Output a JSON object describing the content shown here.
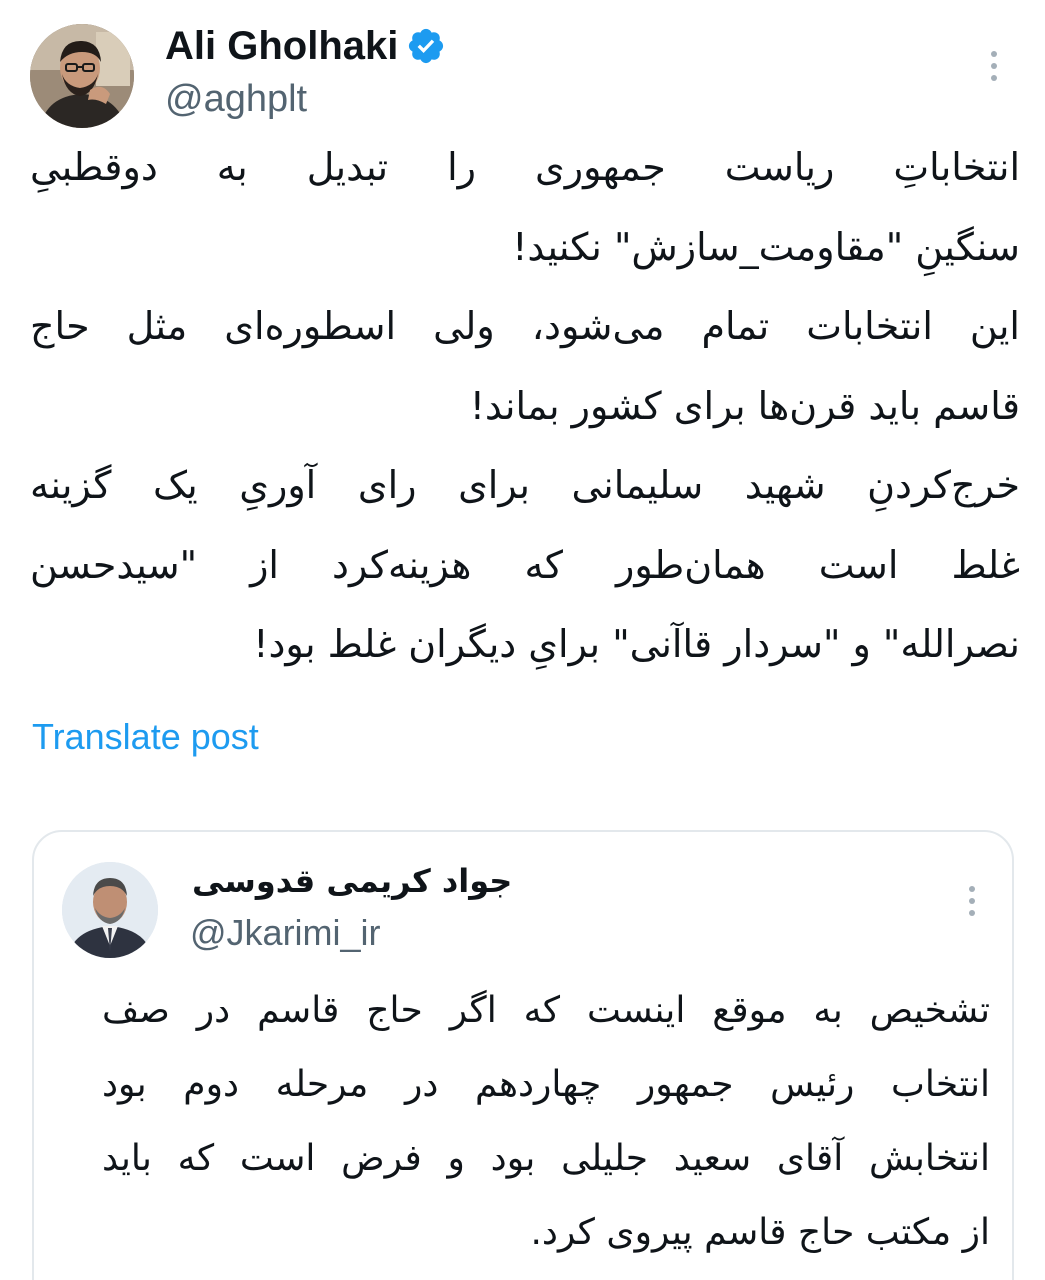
{
  "post": {
    "author_name": "Ali Gholhaki",
    "author_handle": "@aghplt",
    "verified": true,
    "body_lines": [
      "انتخاباتِ ریاست جمهوری را تبدیل به دوقطبیِ",
      "سنگینِ \"مقاومت_سازش\" نکنید!",
      "این انتخابات تمام می‌شود، ولی اسطوره‌ای مثل حاج",
      "قاسم باید قرن‌ها برای کشور بماند!",
      "خرج‌کردنِ شهید سلیمانی برای رای آوریِ یک گزینه",
      "غلط است همان‌طور که هزینه‌کرد از \"سیدحسن",
      "نصرالله\" و \"سردار قاآنی\" برایِ دیگران غلط بود!"
    ],
    "translate_label": "Translate post"
  },
  "quoted_post": {
    "author_name": "جواد کریمی قدوسی",
    "author_handle": "@Jkarimi_ir",
    "body_lines": [
      "تشخیص به موقع اینست که اگر حاج قاسم  در صف",
      "انتخاب رئیس جمهور چهاردهم در مرحله دوم بود",
      "انتخابش آقای سعید جلیلی بود و فرض است که باید",
      "از مکتب حاج قاسم پیروی کرد."
    ]
  },
  "icons": {
    "verified": "verified-badge-icon",
    "more": "more-options-icon"
  },
  "colors": {
    "verified_blue": "#1d9bf0",
    "link_blue": "#1d9bf0",
    "secondary_text": "#536471",
    "primary_text": "#0f1419",
    "card_border": "#e3e8ec"
  }
}
